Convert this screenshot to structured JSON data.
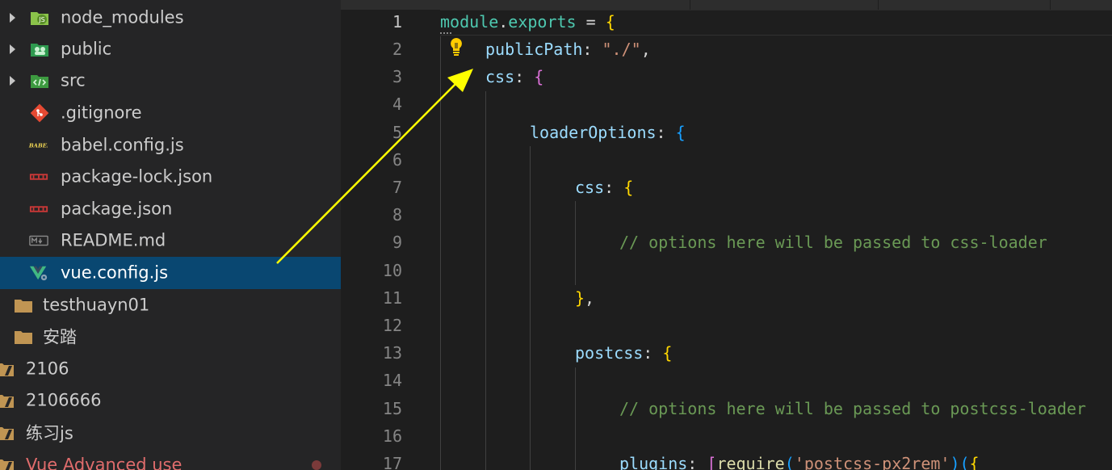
{
  "explorer": {
    "items": [
      {
        "label": "node_modules",
        "icon": "node-modules-folder-icon",
        "kind": "folder",
        "collapsed": true
      },
      {
        "label": "public",
        "icon": "public-folder-icon",
        "kind": "folder",
        "collapsed": true
      },
      {
        "label": "src",
        "icon": "src-folder-icon",
        "kind": "folder",
        "collapsed": true
      },
      {
        "label": ".gitignore",
        "icon": "git-icon",
        "kind": "file"
      },
      {
        "label": "babel.config.js",
        "icon": "babel-icon",
        "kind": "file"
      },
      {
        "label": "package-lock.json",
        "icon": "npm-icon",
        "kind": "file"
      },
      {
        "label": "package.json",
        "icon": "npm-icon",
        "kind": "file"
      },
      {
        "label": "README.md",
        "icon": "markdown-icon",
        "kind": "file"
      },
      {
        "label": "vue.config.js",
        "icon": "vue-icon",
        "kind": "file",
        "selected": true
      },
      {
        "label": "testhuayn01",
        "icon": "folder-icon",
        "kind": "folder"
      },
      {
        "label": "安踏",
        "icon": "folder-icon",
        "kind": "folder"
      },
      {
        "label": "2106",
        "icon": "folder-icon",
        "kind": "folder"
      },
      {
        "label": "2106666",
        "icon": "folder-icon",
        "kind": "folder"
      },
      {
        "label": "练习js",
        "icon": "folder-icon",
        "kind": "folder"
      },
      {
        "label": "Vue Advanced use",
        "icon": "folder-icon",
        "kind": "folder",
        "modified": true
      }
    ]
  },
  "editor": {
    "line_numbers": [
      "1",
      "2",
      "3",
      "4",
      "5",
      "6",
      "7",
      "8",
      "9",
      "10",
      "11",
      "12",
      "13",
      "14",
      "15",
      "16",
      "17"
    ],
    "active_line": "1",
    "lightbulb_icon": "lightbulb-icon",
    "code": {
      "l1_module": "module",
      "l1_dot": ".",
      "l1_exports": "exports",
      "l1_eq": " = ",
      "l1_brace": "{",
      "l2_key": "publicPath",
      "l2_colon": ": ",
      "l2_val": "\"./\"",
      "l2_comma": ",",
      "l3_key": "css",
      "l3_colon": ": ",
      "l3_brace": "{",
      "l5_key": "loaderOptions",
      "l5_colon": ": ",
      "l5_brace": "{",
      "l7_key": "css",
      "l7_colon": ": ",
      "l7_brace": "{",
      "l9_comment": "// options here will be passed to css-loader",
      "l11_brace": "}",
      "l11_comma": ",",
      "l13_key": "postcss",
      "l13_colon": ": ",
      "l13_brace": "{",
      "l15_comment": "// options here will be passed to postcss-loader",
      "l17_key": "plugins",
      "l17_colon": ": ",
      "l17_bracket": "[",
      "l17_fn": "require",
      "l17_paren": "(",
      "l17_str": "'postcss-px2rem'",
      "l17_paren2": ")(",
      "l17_brace": "{"
    }
  },
  "annotation": {
    "type": "arrow",
    "color": "#ffff00"
  },
  "colors": {
    "sidebar_bg": "#252526",
    "editor_bg": "#1e1e1e",
    "selection": "#094771",
    "folder": "#c09553"
  }
}
